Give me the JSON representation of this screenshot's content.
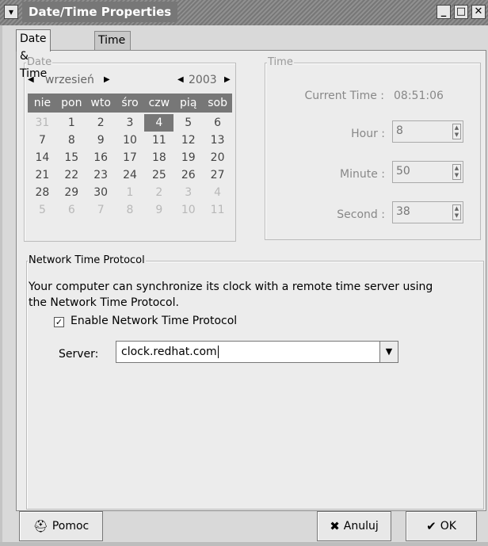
{
  "window": {
    "title": "Date/Time Properties",
    "menu_icon": "chevron-down-icon",
    "minimize_glyph": "_",
    "maximize_glyph": "□",
    "close_glyph": "✕"
  },
  "tabs": [
    {
      "label": "Date & Time",
      "active": true
    },
    {
      "label": "Time Zone",
      "active": false
    }
  ],
  "date": {
    "legend": "Date",
    "month": "wrzesień",
    "year": "2003",
    "weekdays": [
      "nie",
      "pon",
      "wto",
      "śro",
      "czw",
      "pią",
      "sob"
    ],
    "weeks": [
      [
        "31",
        "1",
        "2",
        "3",
        "4",
        "5",
        "6"
      ],
      [
        "7",
        "8",
        "9",
        "10",
        "11",
        "12",
        "13"
      ],
      [
        "14",
        "15",
        "16",
        "17",
        "18",
        "19",
        "20"
      ],
      [
        "21",
        "22",
        "23",
        "24",
        "25",
        "26",
        "27"
      ],
      [
        "28",
        "29",
        "30",
        "1",
        "2",
        "3",
        "4"
      ],
      [
        "5",
        "6",
        "7",
        "8",
        "9",
        "10",
        "11"
      ]
    ],
    "selected_day": "4"
  },
  "time": {
    "legend": "Time",
    "current_label": "Current Time :",
    "current_value": "08:51:06",
    "hour_label": "Hour :",
    "hour_value": "8",
    "minute_label": "Minute :",
    "minute_value": "50",
    "second_label": "Second :",
    "second_value": "38"
  },
  "ntp": {
    "legend": "Network Time Protocol",
    "description": "Your computer can synchronize its clock with a remote time server using the Network Time Protocol.",
    "enable_label": "Enable Network Time Protocol",
    "enable_checked": true,
    "server_label": "Server:",
    "server_value": "clock.redhat.com"
  },
  "buttons": {
    "help": "Pomoc",
    "cancel": "Anuluj",
    "ok": "OK"
  }
}
